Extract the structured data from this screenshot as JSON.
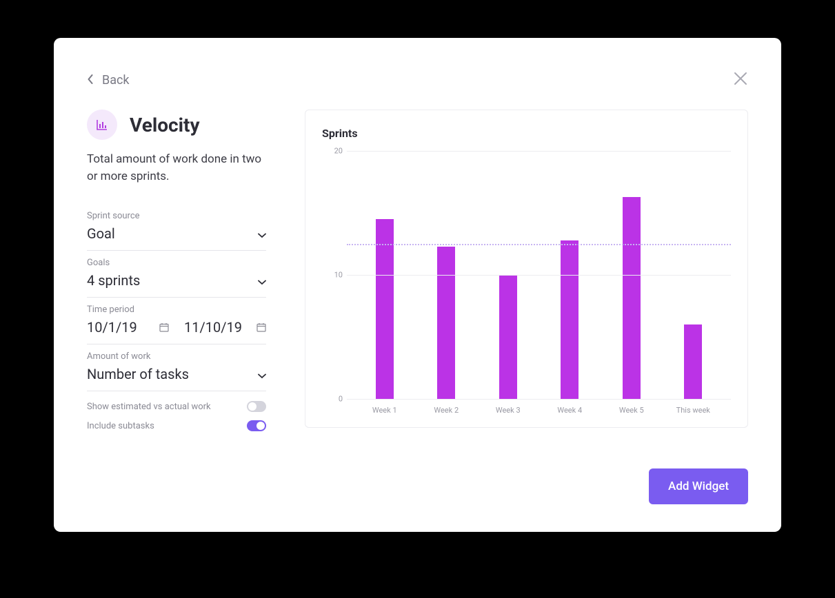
{
  "nav": {
    "back_label": "Back"
  },
  "header": {
    "title": "Velocity",
    "description": "Total amount of work done in two or more sprints."
  },
  "fields": {
    "sprint_source_label": "Sprint source",
    "sprint_source_value": "Goal",
    "goals_label": "Goals",
    "goals_value": "4 sprints",
    "time_period_label": "Time period",
    "date_start": "10/1/19",
    "date_end": "11/10/19",
    "amount_label": "Amount of work",
    "amount_value": "Number of tasks"
  },
  "toggles": {
    "estimated_label": "Show estimated vs actual work",
    "estimated_on": false,
    "subtasks_label": "Include subtasks",
    "subtasks_on": true
  },
  "chart_data": {
    "type": "bar",
    "title": "Sprints",
    "categories": [
      "Week 1",
      "Week 2",
      "Week 3",
      "Week 4",
      "Week 5",
      "This week"
    ],
    "values": [
      14.5,
      12.3,
      10,
      12.8,
      16.3,
      6
    ],
    "ylim": [
      0,
      20
    ],
    "yticks": [
      0,
      10,
      20
    ],
    "average_line": 12.5
  },
  "actions": {
    "add_label": "Add Widget"
  },
  "colors": {
    "bar": "#bb33e6",
    "accent": "#7a5cf0"
  }
}
